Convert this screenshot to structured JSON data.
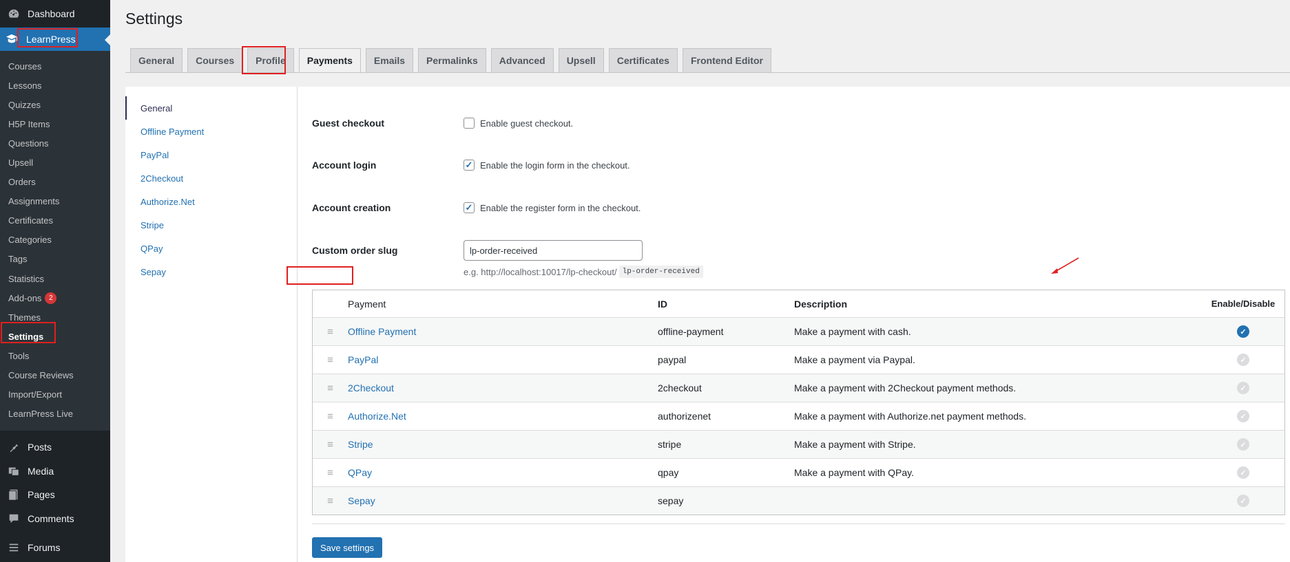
{
  "sidebar": {
    "dashboard": "Dashboard",
    "learnpress": "LearnPress",
    "submenu": [
      "Courses",
      "Lessons",
      "Quizzes",
      "H5P Items",
      "Questions",
      "Upsell",
      "Orders",
      "Assignments",
      "Certificates",
      "Categories",
      "Tags",
      "Statistics",
      "Add-ons",
      "Themes",
      "Settings",
      "Tools",
      "Course Reviews",
      "Import/Export",
      "LearnPress Live"
    ],
    "addons_badge": "2",
    "lower": [
      "Posts",
      "Media",
      "Pages",
      "Comments",
      "Forums"
    ]
  },
  "page": {
    "title": "Settings"
  },
  "tabs": [
    "General",
    "Courses",
    "Profile",
    "Payments",
    "Emails",
    "Permalinks",
    "Advanced",
    "Upsell",
    "Certificates",
    "Frontend Editor"
  ],
  "active_tab": "Payments",
  "subnav": [
    "General",
    "Offline Payment",
    "PayPal",
    "2Checkout",
    "Authorize.Net",
    "Stripe",
    "QPay",
    "Sepay"
  ],
  "fields": {
    "guest": {
      "label": "Guest checkout",
      "desc": "Enable guest checkout.",
      "checked": false
    },
    "login": {
      "label": "Account login",
      "desc": "Enable the login form in the checkout.",
      "checked": true
    },
    "creation": {
      "label": "Account creation",
      "desc": "Enable the register form in the checkout.",
      "checked": true
    },
    "slug": {
      "label": "Custom order slug",
      "value": "lp-order-received",
      "example_prefix": "e.g. http://localhost:10017/lp-checkout/",
      "example_code": "lp-order-received"
    }
  },
  "payments_table": {
    "headers": {
      "payment": "Payment",
      "id": "ID",
      "description": "Description",
      "enable": "Enable/Disable"
    },
    "rows": [
      {
        "name": "Offline Payment",
        "id": "offline-payment",
        "description": "Make a payment with cash.",
        "enabled": true
      },
      {
        "name": "PayPal",
        "id": "paypal",
        "description": "Make a payment via Paypal.",
        "enabled": false
      },
      {
        "name": "2Checkout",
        "id": "2checkout",
        "description": "Make a payment with 2Checkout payment methods.",
        "enabled": false
      },
      {
        "name": "Authorize.Net",
        "id": "authorizenet",
        "description": "Make a payment with Authorize.net payment methods.",
        "enabled": false
      },
      {
        "name": "Stripe",
        "id": "stripe",
        "description": "Make a payment with Stripe.",
        "enabled": false
      },
      {
        "name": "QPay",
        "id": "qpay",
        "description": "Make a payment with QPay.",
        "enabled": false
      },
      {
        "name": "Sepay",
        "id": "sepay",
        "description": "",
        "enabled": false
      }
    ]
  },
  "save_button": "Save settings",
  "colors": {
    "accent": "#2271b1",
    "sidebar_bg": "#1d2327",
    "highlight": "#e02020"
  }
}
